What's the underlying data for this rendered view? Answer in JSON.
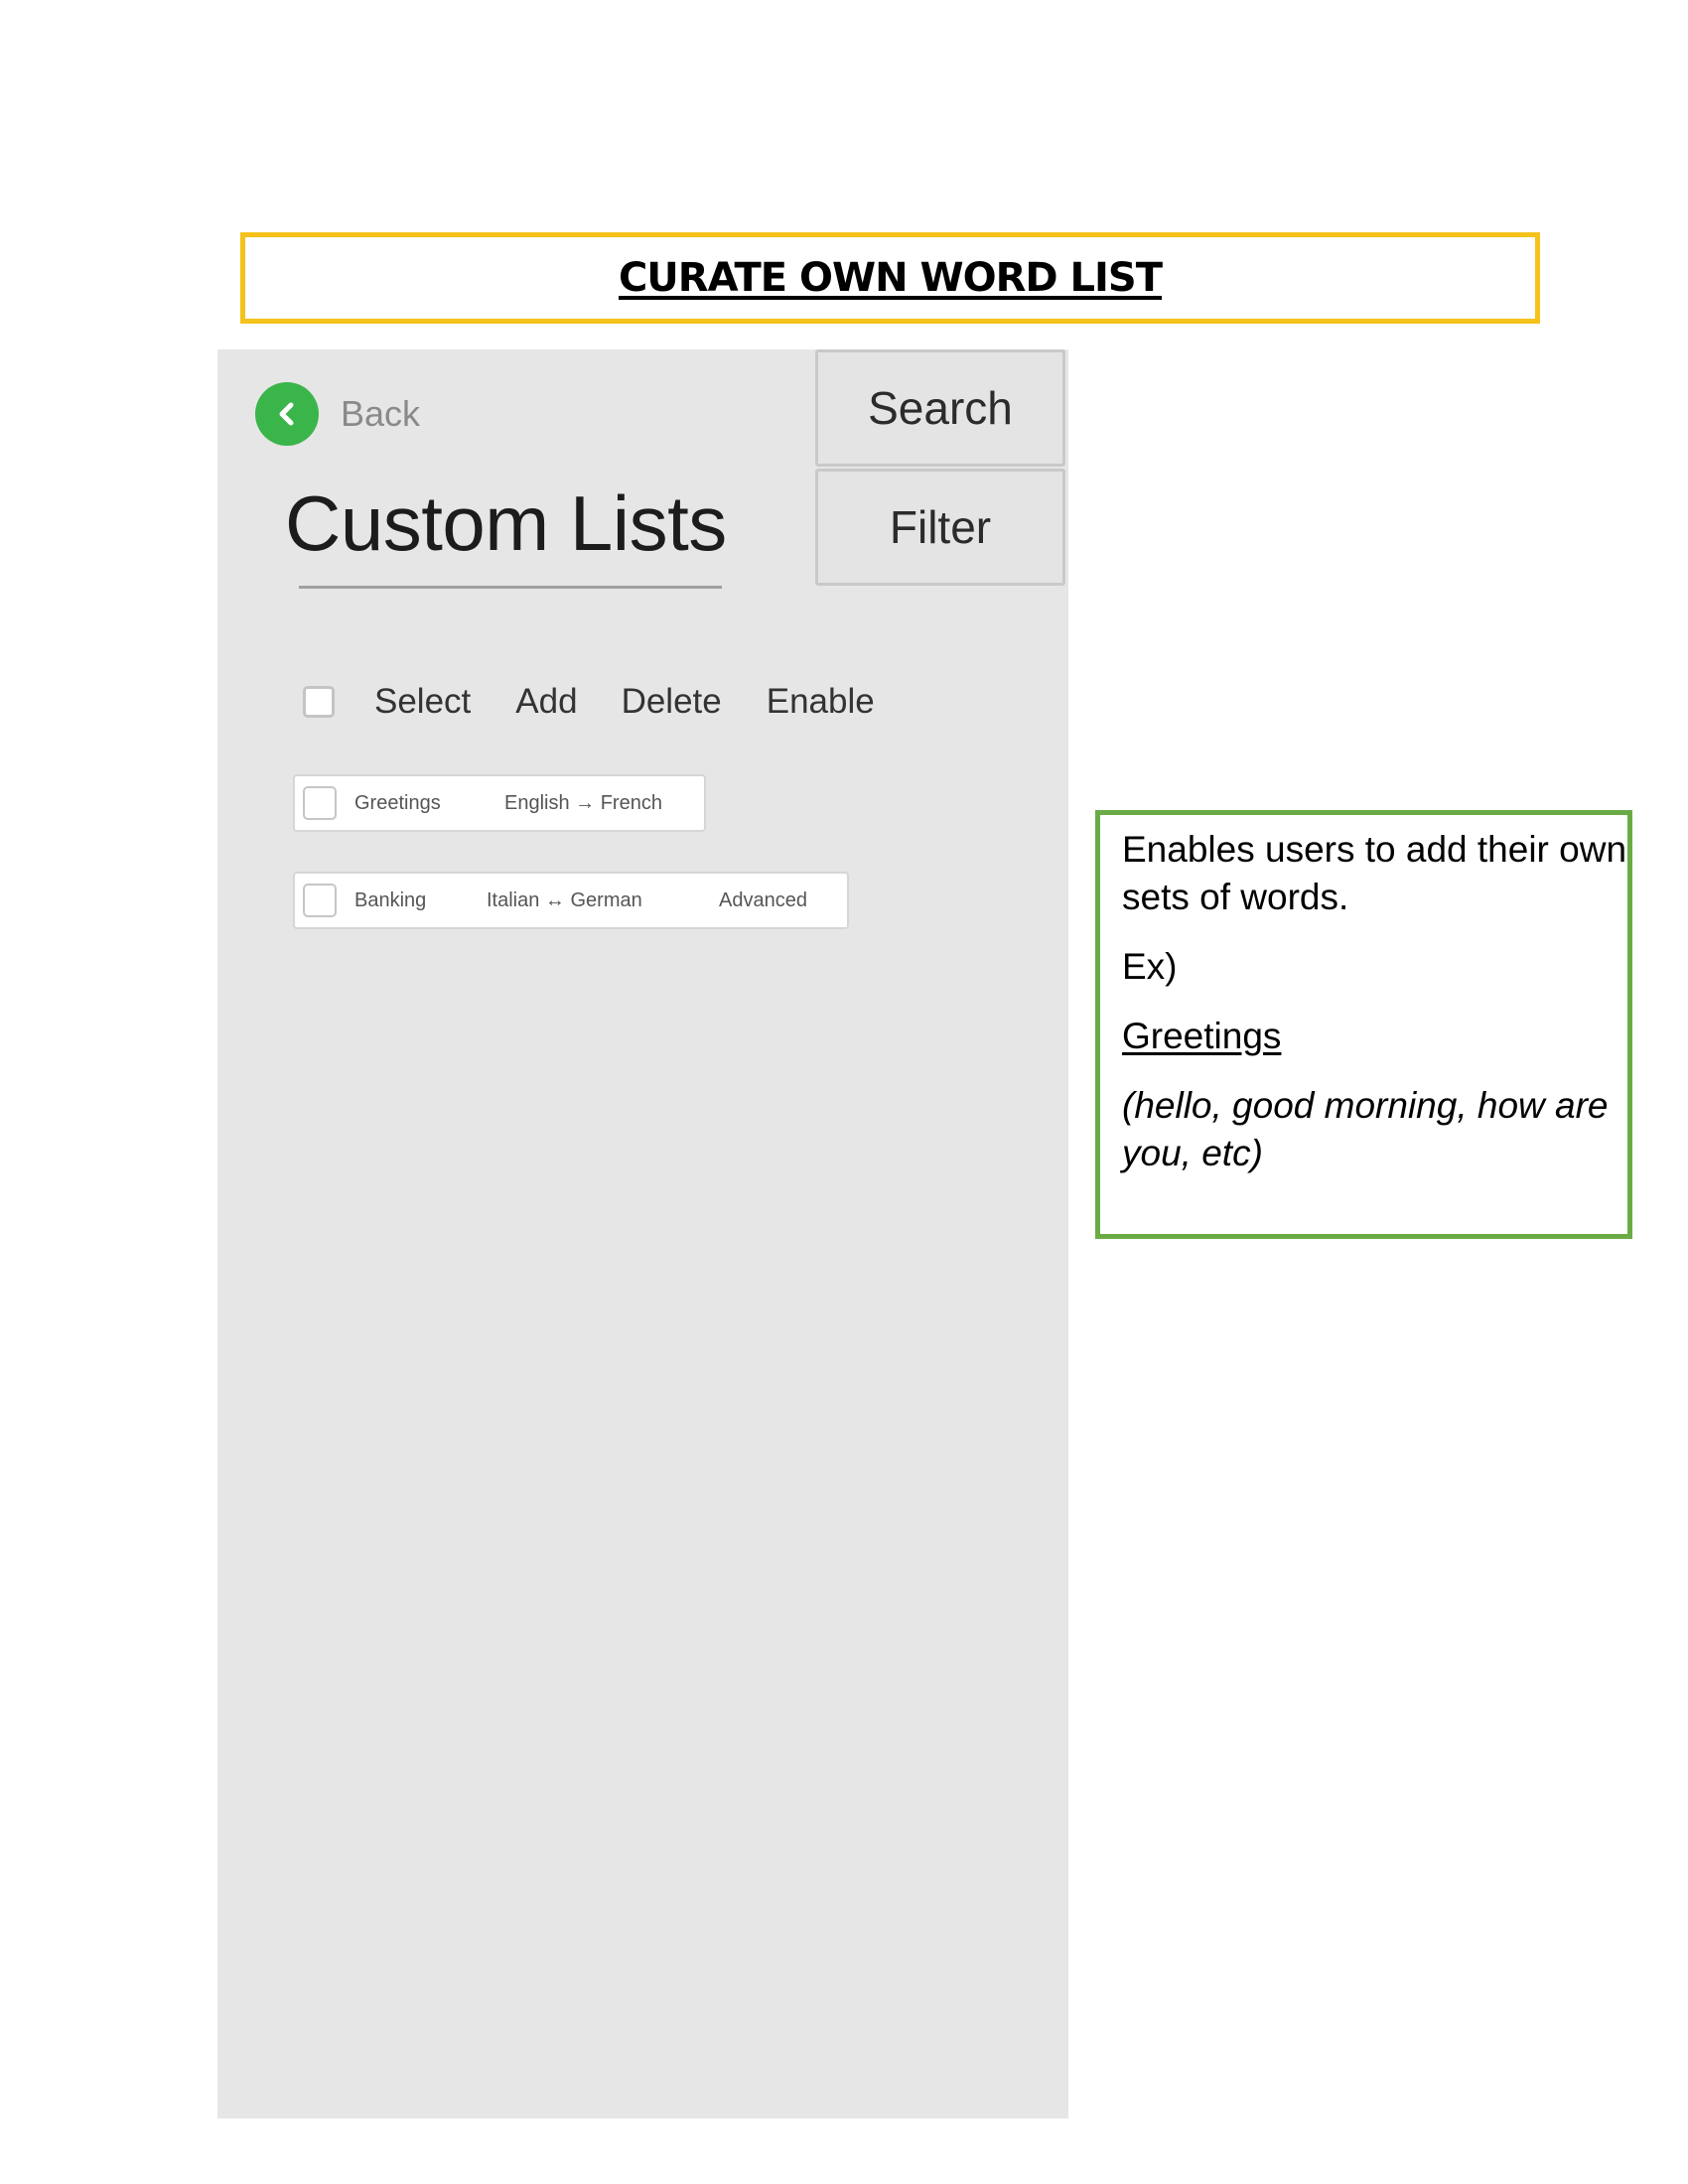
{
  "header": {
    "title": "CURATE OWN WORD LIST"
  },
  "app": {
    "back_label": "Back",
    "page_title": "Custom Lists",
    "search_label": "Search",
    "filter_label": "Filter",
    "toolbar": {
      "select_label": "Select",
      "add_label": "Add",
      "delete_label": "Delete",
      "enable_label": "Enable"
    },
    "lists": [
      {
        "name": "Greetings",
        "languages": "English → French",
        "level": ""
      },
      {
        "name": "Banking",
        "languages": "Italian ↔ German",
        "level": "Advanced"
      }
    ]
  },
  "annotation": {
    "description": "Enables users to add their own sets of words.",
    "example_prefix": "Ex)",
    "example_title": "Greetings",
    "example_words": "(hello, good morning, how are you, etc)"
  },
  "colors": {
    "title_border": "#f5c21b",
    "note_border": "#6bab45",
    "back_icon": "#3ab54a",
    "phone_background": "#e6e6e6"
  },
  "icons": {
    "back": "chevron-left-icon"
  }
}
